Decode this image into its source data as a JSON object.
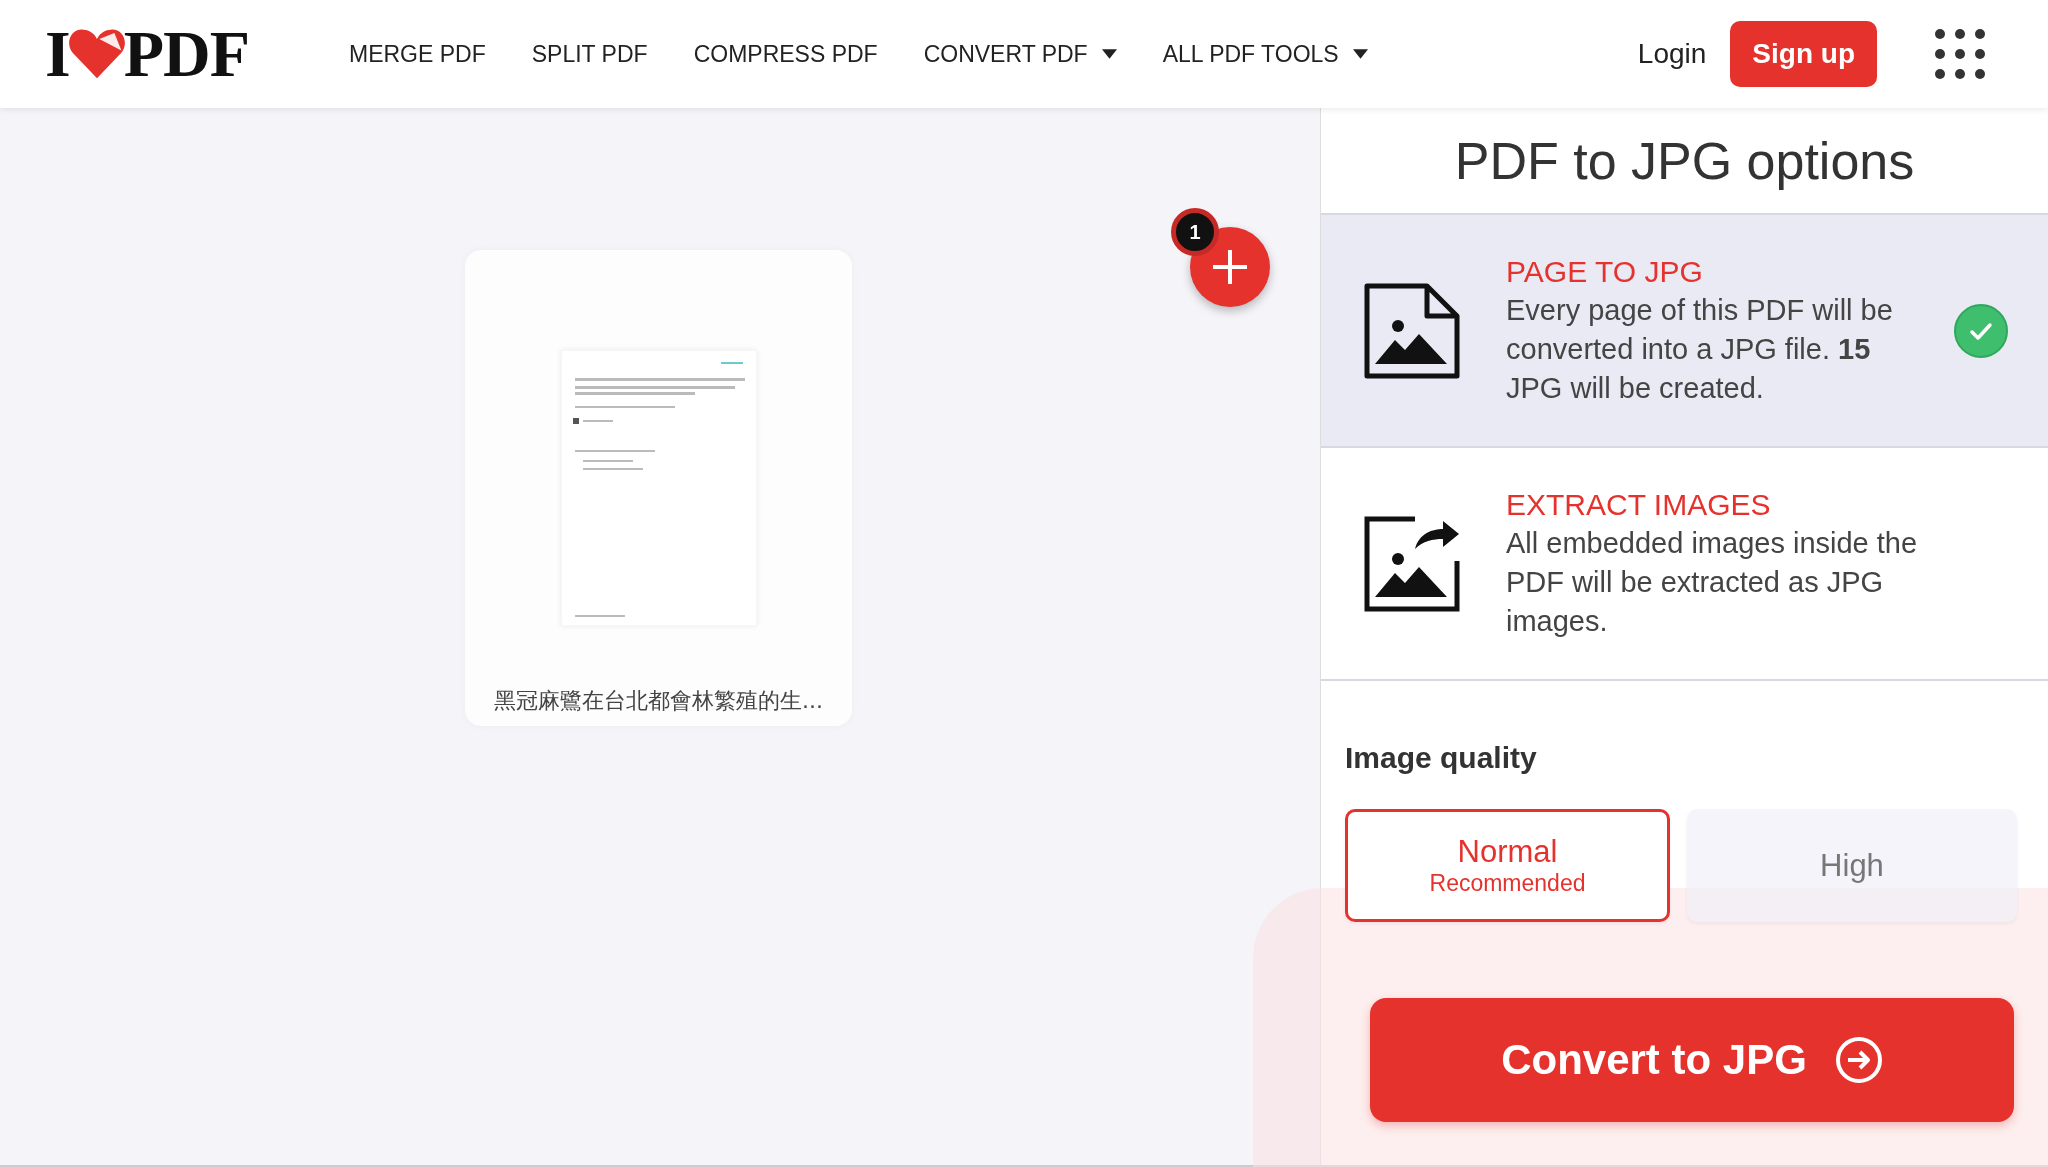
{
  "logo": {
    "text_left": "I",
    "text_right": "PDF"
  },
  "nav": [
    {
      "label": "MERGE PDF",
      "dropdown": false
    },
    {
      "label": "SPLIT PDF",
      "dropdown": false
    },
    {
      "label": "COMPRESS PDF",
      "dropdown": false
    },
    {
      "label": "CONVERT PDF",
      "dropdown": true
    },
    {
      "label": "ALL PDF TOOLS",
      "dropdown": true
    }
  ],
  "auth": {
    "login": "Login",
    "signup": "Sign up"
  },
  "file": {
    "name": "黑冠麻鷺在台北都會林繁殖的生...",
    "count": "1"
  },
  "options_panel": {
    "title": "PDF to JPG options",
    "options": [
      {
        "kind": "page",
        "title": "PAGE TO JPG",
        "description": "Every page of this PDF will be converted into a JPG file. **15** JPG will be created.",
        "selected": true
      },
      {
        "kind": "extract",
        "title": "EXTRACT IMAGES",
        "description": "All embedded images inside the PDF will be extracted as JPG images.",
        "selected": false
      }
    ],
    "quality": {
      "label": "Image quality",
      "choices": [
        {
          "label": "Normal",
          "sublabel": "Recommended",
          "selected": true
        },
        {
          "label": "High",
          "selected": false
        }
      ]
    },
    "convert_button": "Convert to JPG"
  }
}
